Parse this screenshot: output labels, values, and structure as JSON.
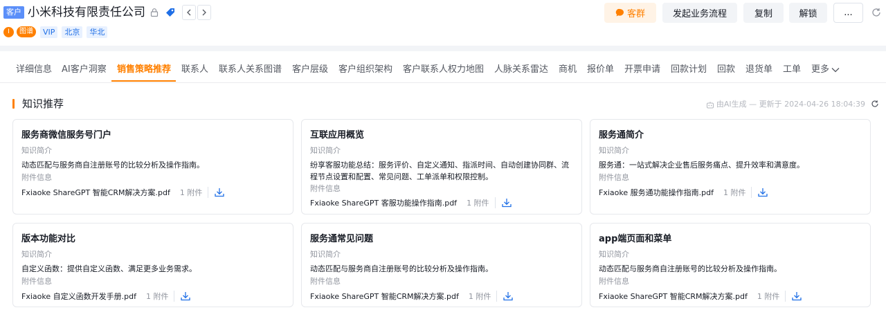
{
  "header": {
    "type_tag": "客户",
    "company_name": "小米科技有限责任公司",
    "icons": [
      "lock-icon",
      "tag-icon",
      "chevron-left-icon",
      "chevron-right-icon",
      "refresh-icon"
    ],
    "dot_letter": "I",
    "badge": "图谱",
    "tags": [
      "VIP",
      "北京",
      "华北"
    ],
    "buttons": {
      "kequn": "客群",
      "start_flow": "发起业务流程",
      "copy": "复制",
      "unlock": "解锁",
      "more": "..."
    }
  },
  "tabs": {
    "items": [
      "详细信息",
      "AI客户洞察",
      "销售策略推荐",
      "联系人",
      "联系人关系图谱",
      "客户层级",
      "客户组织架构",
      "客户联系人权力地图",
      "人脉关系雷达",
      "商机",
      "报价单",
      "开票申请",
      "回款计划",
      "回款",
      "退货单",
      "工单",
      "更多"
    ],
    "active": "销售策略推荐"
  },
  "section": {
    "title": "知识推荐",
    "ai_note": "由AI生成 — 更新于 2024-04-26 18:04:39"
  },
  "labels": {
    "intro": "知识简介",
    "attachment_info": "附件信息"
  },
  "cards": [
    {
      "title": "服务商微信服务号门户",
      "desc": "动态匹配与服务商自注册账号的比较分析及操作指南。",
      "file": "Fxiaoke ShareGPT 智能CRM解决方案.pdf",
      "count": "1 附件"
    },
    {
      "title": "互联应用概览",
      "desc": "纷享客服功能总结：服务评价、自定义通知、指派时间、自动创建协同群、流程节点设置和配置、常见问题、工单派单和权限控制。",
      "file": "Fxiaoke ShareGPT 客服功能操作指南.pdf",
      "count": "1 附件"
    },
    {
      "title": "服务通简介",
      "desc": "服务通：一站式解决企业售后服务痛点、提升效率和满意度。",
      "file": "Fxiaoke 服务通功能操作指南.pdf",
      "count": "1 附件"
    },
    {
      "title": "版本功能对比",
      "desc": "自定义函数：提供自定义函数、满足更多业务需求。",
      "file": "Fxiaoke 自定义函数开发手册.pdf",
      "count": "1 附件"
    },
    {
      "title": "服务通常见问题",
      "desc": "动态匹配与服务商自注册账号的比较分析及操作指南。",
      "file": "Fxiaoke ShareGPT 智能CRM解决方案.pdf",
      "count": "1 附件"
    },
    {
      "title": "app端页面和菜单",
      "desc": "动态匹配与服务商自注册账号的比较分析及操作指南。",
      "file": "Fxiaoke ShareGPT 智能CRM解决方案.pdf",
      "count": "1 附件"
    }
  ],
  "colors": {
    "accent": "#ff8000",
    "blue": "#1f6fe6",
    "tag_bg": "#e8f1ff"
  }
}
